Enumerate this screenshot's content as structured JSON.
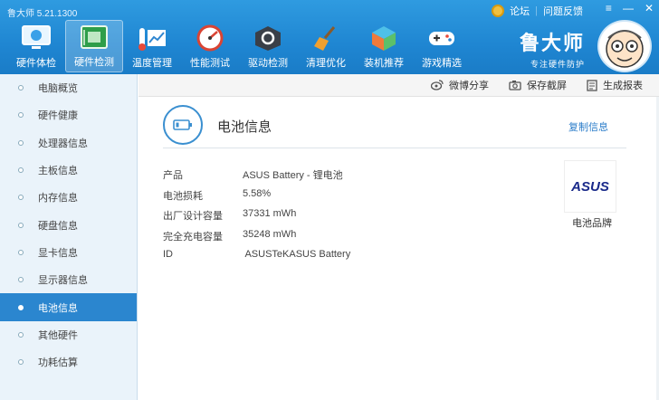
{
  "app": {
    "title": "鲁大师 5.21.1300"
  },
  "top_links": {
    "forum": "论坛",
    "feedback": "问题反馈"
  },
  "window_controls": {
    "menu": "≡",
    "minimize": "—",
    "close": "✕"
  },
  "toolbar": [
    {
      "label": "硬件体检",
      "icon": "monitor-checkup-icon"
    },
    {
      "label": "硬件检测",
      "icon": "circuit-board-icon"
    },
    {
      "label": "温度管理",
      "icon": "thermometer-chart-icon"
    },
    {
      "label": "性能测试",
      "icon": "speedometer-icon"
    },
    {
      "label": "驱动检测",
      "icon": "gear-box-icon"
    },
    {
      "label": "清理优化",
      "icon": "broom-icon"
    },
    {
      "label": "装机推荐",
      "icon": "cube-icon"
    },
    {
      "label": "游戏精选",
      "icon": "gamepad-icon"
    }
  ],
  "brand": {
    "name": "鲁大师",
    "slogan": "专注硬件防护"
  },
  "sidebar": {
    "items": [
      {
        "label": "电脑概览"
      },
      {
        "label": "硬件健康"
      },
      {
        "label": "处理器信息"
      },
      {
        "label": "主板信息"
      },
      {
        "label": "内存信息"
      },
      {
        "label": "硬盘信息"
      },
      {
        "label": "显卡信息"
      },
      {
        "label": "显示器信息"
      },
      {
        "label": "电池信息"
      },
      {
        "label": "其他硬件"
      },
      {
        "label": "功耗估算"
      }
    ],
    "active_index": 8
  },
  "actions": {
    "share": "微博分享",
    "screenshot": "保存截屏",
    "report": "生成报表"
  },
  "section": {
    "title": "电池信息",
    "copy": "复制信息"
  },
  "battery": {
    "rows": [
      {
        "key": "产品",
        "value": "ASUS Battery -   锂电池"
      },
      {
        "key": "电池损耗",
        "value": "5.58%"
      },
      {
        "key": "出厂设计容量",
        "value": "37331 mWh"
      },
      {
        "key": "完全充电容量",
        "value": "35248 mWh"
      },
      {
        "key": "ID",
        "value": " ASUSTeKASUS Battery"
      }
    ]
  },
  "brand_logo": {
    "text": "ASUS",
    "caption": "电池品牌"
  },
  "colors": {
    "header": "#1f86d2",
    "active": "#2b86cf",
    "link": "#2a7cc9"
  }
}
